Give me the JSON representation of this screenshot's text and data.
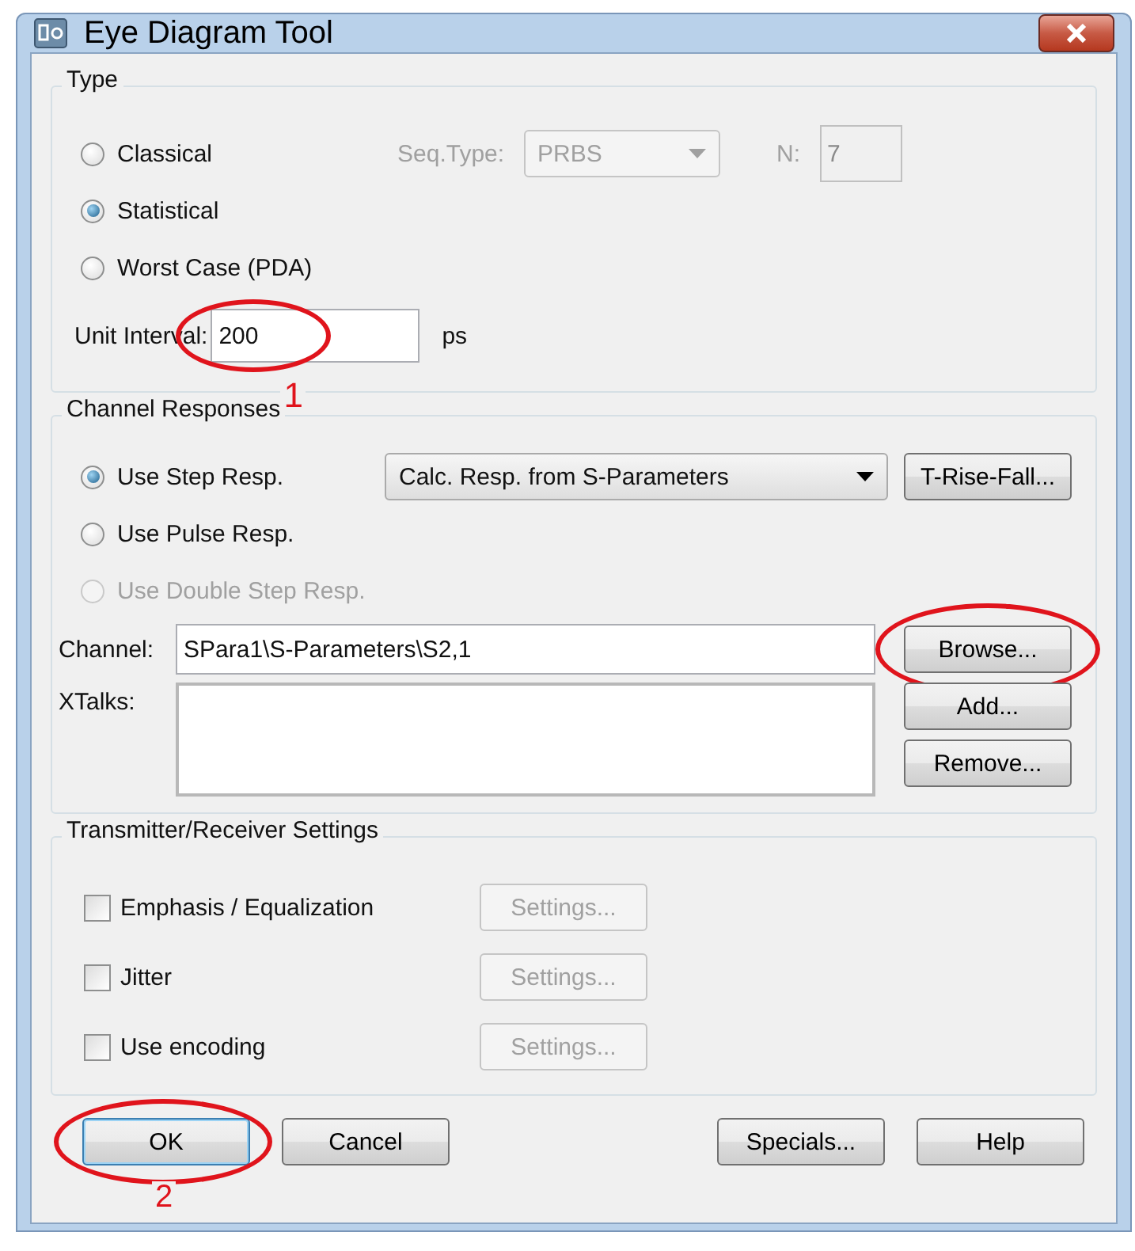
{
  "window": {
    "title": "Eye Diagram Tool"
  },
  "type_group": {
    "title": "Type",
    "options": [
      {
        "label": "Classical",
        "selected": false,
        "disabled": false
      },
      {
        "label": "Statistical",
        "selected": true,
        "disabled": false
      },
      {
        "label": "Worst Case (PDA)",
        "selected": false,
        "disabled": false
      }
    ],
    "seq_type": {
      "label": "Seq.Type:",
      "value": "PRBS",
      "disabled": true
    },
    "n": {
      "label": "N:",
      "value": "7",
      "disabled": true
    },
    "unit_interval": {
      "label": "Unit Interval:",
      "value": "200",
      "unit": "ps",
      "circled": true,
      "callout": "1"
    }
  },
  "channel_group": {
    "title": "Channel Responses",
    "options": [
      {
        "label": "Use Step Resp.",
        "selected": true,
        "disabled": false
      },
      {
        "label": "Use Pulse Resp.",
        "selected": false,
        "disabled": false
      },
      {
        "label": "Use Double Step Resp.",
        "selected": false,
        "disabled": true
      }
    ],
    "method": {
      "value": "Calc. Resp. from S-Parameters"
    },
    "rise_fall_button": {
      "label": "T-Rise-Fall...",
      "circled": false
    },
    "channel": {
      "label": "Channel:",
      "value": "SPara1\\S-Parameters\\S2,1"
    },
    "browse_button": {
      "label": "Browse...",
      "circled": true
    },
    "xtalks": {
      "label": "XTalks:"
    },
    "xtalk_buttons": [
      {
        "label": "Add...",
        "circled": false
      },
      {
        "label": "Remove...",
        "circled": false
      }
    ]
  },
  "txrx_group": {
    "title": "Transmitter/Receiver Settings",
    "rows": [
      {
        "label": "Emphasis / Equalization",
        "checked": false,
        "button": "Settings...",
        "button_disabled": true
      },
      {
        "label": "Jitter",
        "checked": false,
        "button": "Settings...",
        "button_disabled": true
      },
      {
        "label": "Use encoding",
        "checked": false,
        "button": "Settings...",
        "button_disabled": true
      }
    ]
  },
  "buttons": [
    {
      "label": "OK",
      "default": true,
      "circled": true,
      "callout": "2"
    },
    {
      "label": "Cancel",
      "default": false,
      "circled": false
    },
    {
      "label": "Specials...",
      "default": false,
      "circled": false
    },
    {
      "label": "Help",
      "default": false,
      "circled": false
    }
  ]
}
